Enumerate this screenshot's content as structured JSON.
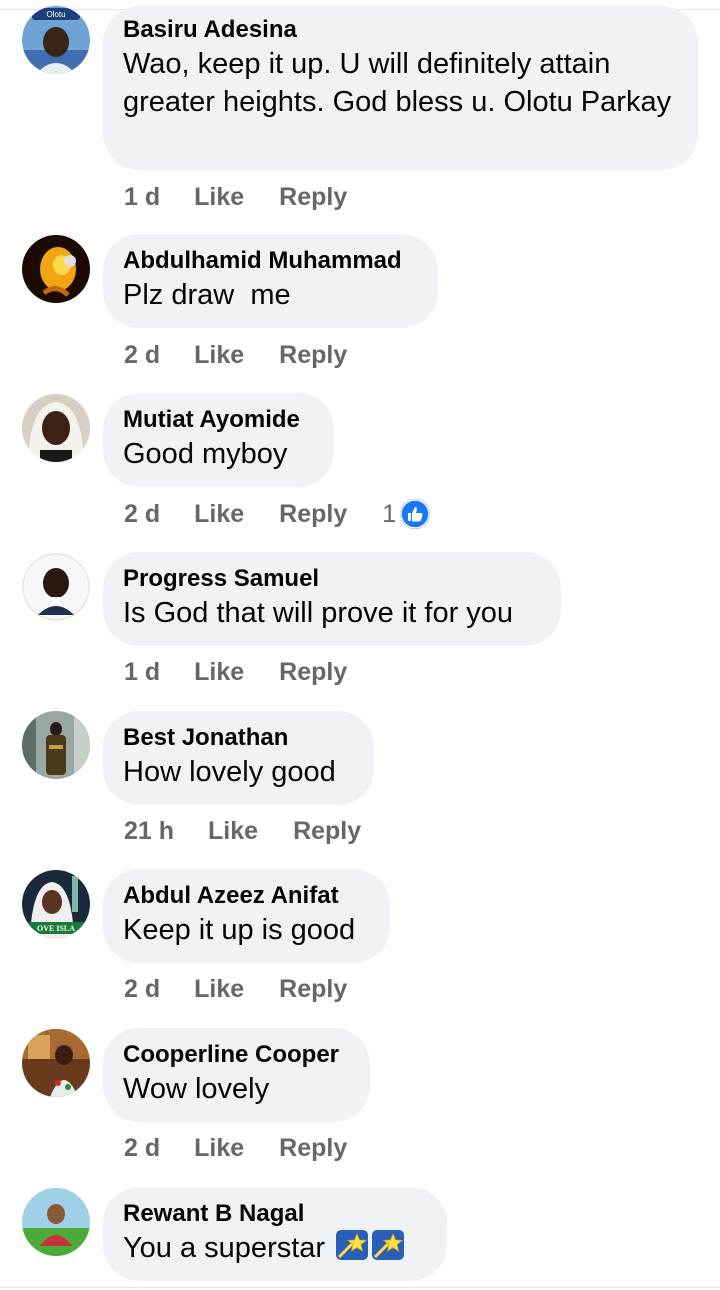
{
  "comments": [
    {
      "author": "Basiru Adesina",
      "text": "Wao, keep it up. U will definitely attain greater heights. God bless u. Olotu Parkay",
      "time": "1 d",
      "like_label": "Like",
      "reply_label": "Reply",
      "avatar_badge": "Olotu"
    },
    {
      "author": "Abdulhamid Muhammad",
      "text": "Plz draw  me",
      "time": "2 d",
      "like_label": "Like",
      "reply_label": "Reply"
    },
    {
      "author": "Mutiat Ayomide",
      "text": "Good myboy",
      "time": "2 d",
      "like_label": "Like",
      "reply_label": "Reply",
      "reaction_count": "1",
      "reaction_icon": "thumbs-up-icon"
    },
    {
      "author": "Progress Samuel",
      "text": "Is God that will prove it for you",
      "time": "1 d",
      "like_label": "Like",
      "reply_label": "Reply"
    },
    {
      "author": "Best Jonathan",
      "text": "How lovely good",
      "time": "21 h",
      "like_label": "Like",
      "reply_label": "Reply"
    },
    {
      "author": "Abdul Azeez Anifat",
      "text": "Keep it up is good",
      "time": "2 d",
      "like_label": "Like",
      "reply_label": "Reply",
      "avatar_badge": "OVE ISLA"
    },
    {
      "author": "Cooperline Cooper",
      "text": "Wow lovely",
      "time": "2 d",
      "like_label": "Like",
      "reply_label": "Reply"
    },
    {
      "author": "Rewant B Nagal",
      "text": "You a superstar",
      "emojis": [
        "shooting-star-icon",
        "shooting-star-icon"
      ]
    }
  ],
  "colors": {
    "bubble": "#f0f2f5",
    "meta_text": "#65676b",
    "like_blue": "#1877f2",
    "text": "#050505"
  }
}
